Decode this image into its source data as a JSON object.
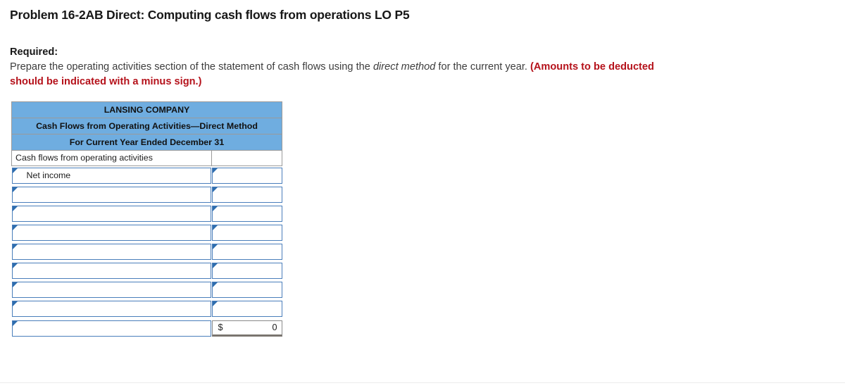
{
  "question": {
    "title": "Problem 16-2AB Direct: Computing cash flows from operations LO P5"
  },
  "required": {
    "label": "Required:",
    "text_before_italic": "Prepare the operating activities section of the statement of cash flows using the ",
    "italic_term": "direct method",
    "text_after_italic": " for the current year. ",
    "red_note": "(Amounts to be deducted should be indicated with a minus sign.)"
  },
  "worksheet": {
    "headers": [
      "LANSING COMPANY",
      "Cash Flows from Operating Activities—Direct Method",
      "For Current Year Ended December 31"
    ],
    "section_label": "Cash flows from operating activities",
    "section_amount": "",
    "rows": [
      {
        "label": "Net income",
        "amount": ""
      },
      {
        "label": "",
        "amount": ""
      },
      {
        "label": "",
        "amount": ""
      },
      {
        "label": "",
        "amount": ""
      },
      {
        "label": "",
        "amount": ""
      },
      {
        "label": "",
        "amount": ""
      },
      {
        "label": "",
        "amount": ""
      },
      {
        "label": "",
        "amount": ""
      }
    ],
    "total_row": {
      "label": "",
      "currency_symbol": "$",
      "value": "0"
    }
  },
  "colors": {
    "header_blue": "#6FADE0",
    "input_border_blue": "#4A7EBB",
    "marker_blue": "#2E6DAE",
    "red_note": "#b5121b"
  }
}
